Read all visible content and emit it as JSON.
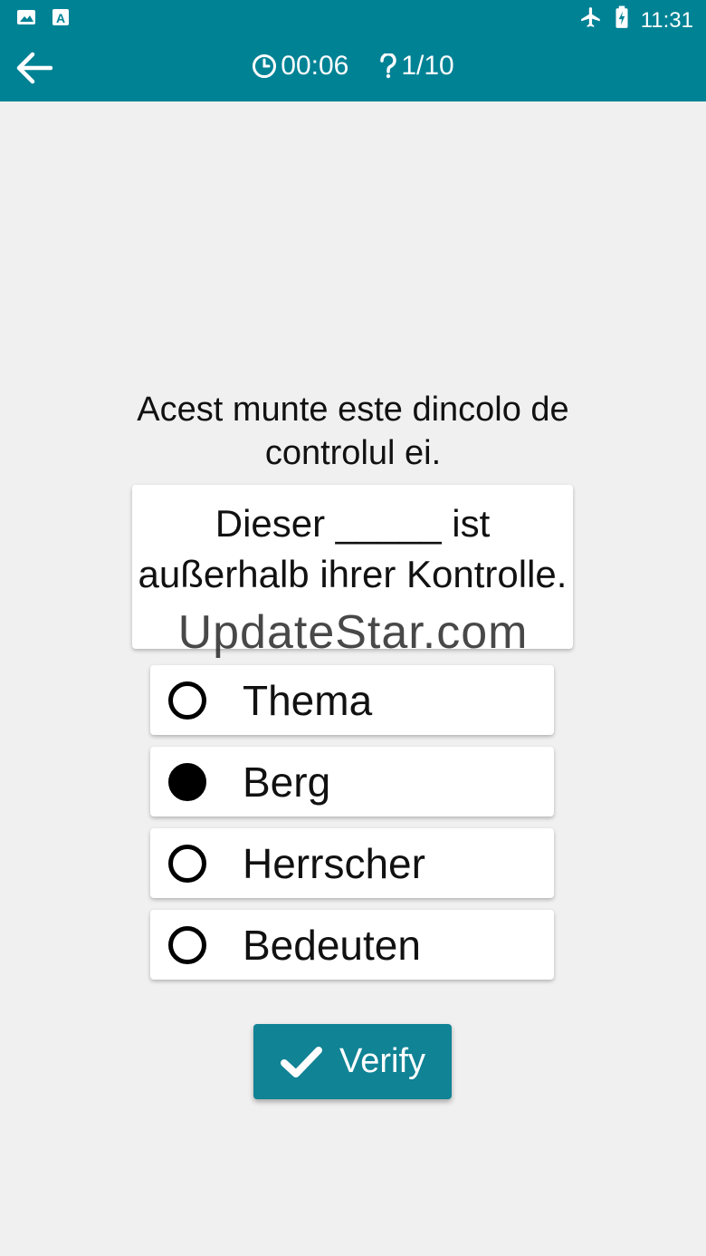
{
  "status_bar": {
    "left_icons": [
      "image-icon",
      "text-a-icon"
    ],
    "right_icons": [
      "airplane-icon",
      "battery-charging-icon"
    ],
    "time": "11:31"
  },
  "header": {
    "timer": "00:06",
    "progress": "1/10",
    "colors": {
      "bar": "#008295"
    }
  },
  "question": {
    "prompt": "Acest munte este dincolo de controlul ei.",
    "sentence": "Dieser _____ ist außerhalb ihrer Kontrolle."
  },
  "watermark": "UpdateStar.com",
  "options": [
    {
      "label": "Thema",
      "selected": false
    },
    {
      "label": "Berg",
      "selected": true
    },
    {
      "label": "Herrscher",
      "selected": false
    },
    {
      "label": "Bedeuten",
      "selected": false
    }
  ],
  "verify": {
    "label": "Verify"
  }
}
